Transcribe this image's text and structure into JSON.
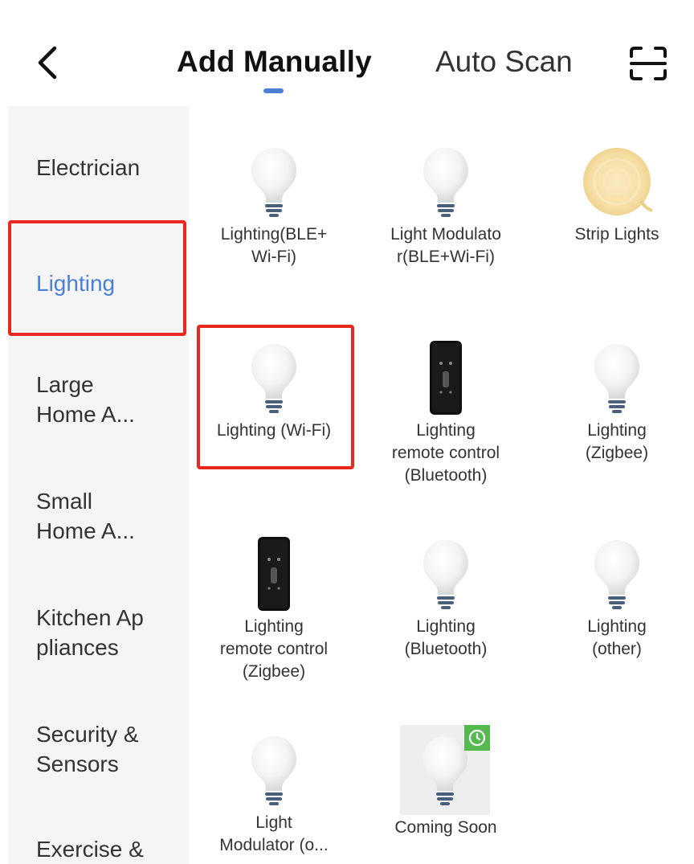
{
  "header": {
    "tab_manual": "Add Manually",
    "tab_auto": "Auto Scan",
    "accent": "#4a7fd8"
  },
  "sidebar": {
    "items": [
      {
        "label": "Electrician"
      },
      {
        "label": "Lighting"
      },
      {
        "label": "Large\nHome A..."
      },
      {
        "label": "Small\nHome A..."
      },
      {
        "label": "Kitchen Ap\npliances"
      },
      {
        "label": "Security &\nSensors"
      },
      {
        "label": "Exercise &"
      }
    ],
    "active_index": 1
  },
  "devices": [
    {
      "label": "Lighting(BLE+\nWi-Fi)",
      "icon": "bulb-icon"
    },
    {
      "label": "Light Modulato\nr(BLE+Wi-Fi)",
      "icon": "bulb-icon"
    },
    {
      "label": "Strip Lights",
      "icon": "strip-light-icon"
    },
    {
      "label": "Lighting (Wi-Fi)",
      "icon": "bulb-icon"
    },
    {
      "label": "Lighting\nremote control\n(Bluetooth)",
      "icon": "remote-icon"
    },
    {
      "label": "Lighting\n(Zigbee)",
      "icon": "bulb-icon"
    },
    {
      "label": "Lighting\nremote control\n(Zigbee)",
      "icon": "remote-icon"
    },
    {
      "label": "Lighting\n(Bluetooth)",
      "icon": "bulb-icon"
    },
    {
      "label": "Lighting\n(other)",
      "icon": "bulb-icon"
    },
    {
      "label": "Light\nModulator (o...",
      "icon": "bulb-icon"
    },
    {
      "label": "Coming Soon",
      "icon": "bulb-icon"
    }
  ],
  "colors": {
    "highlight": "#e8271f",
    "badge": "#55b94f"
  }
}
